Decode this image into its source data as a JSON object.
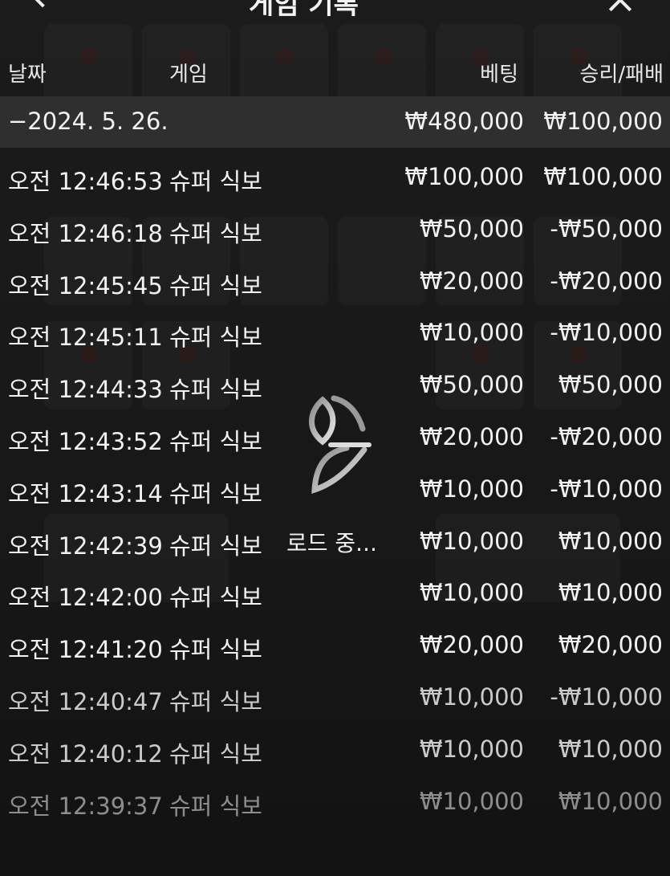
{
  "header": {
    "title": "게임 기록"
  },
  "columns": {
    "date": "날짜",
    "game": "게임",
    "bet": "베팅",
    "result": "승리/패배"
  },
  "date_group": {
    "date": "−2024. 5. 26.",
    "bet_total": "₩480,000",
    "result_total": "₩100,000"
  },
  "rows": [
    {
      "time": "오전 12:46:53",
      "game": "슈퍼 식보",
      "bet": "₩100,000",
      "result": "₩100,000"
    },
    {
      "time": "오전 12:46:18",
      "game": "슈퍼 식보",
      "bet": "₩50,000",
      "result": "-₩50,000"
    },
    {
      "time": "오전 12:45:45",
      "game": "슈퍼 식보",
      "bet": "₩20,000",
      "result": "-₩20,000"
    },
    {
      "time": "오전 12:45:11",
      "game": "슈퍼 식보",
      "bet": "₩10,000",
      "result": "-₩10,000"
    },
    {
      "time": "오전 12:44:33",
      "game": "슈퍼 식보",
      "bet": "₩50,000",
      "result": "₩50,000"
    },
    {
      "time": "오전 12:43:52",
      "game": "슈퍼 식보",
      "bet": "₩20,000",
      "result": "-₩20,000"
    },
    {
      "time": "오전 12:43:14",
      "game": "슈퍼 식보",
      "bet": "₩10,000",
      "result": "-₩10,000"
    },
    {
      "time": "오전 12:42:39",
      "game": "슈퍼 식보",
      "bet": "₩10,000",
      "result": "₩10,000"
    },
    {
      "time": "오전 12:42:00",
      "game": "슈퍼 식보",
      "bet": "₩10,000",
      "result": "₩10,000"
    },
    {
      "time": "오전 12:41:20",
      "game": "슈퍼 식보",
      "bet": "₩20,000",
      "result": "₩20,000"
    },
    {
      "time": "오전 12:40:47",
      "game": "슈퍼 식보",
      "bet": "₩10,000",
      "result": "-₩10,000"
    },
    {
      "time": "오전 12:40:12",
      "game": "슈퍼 식보",
      "bet": "₩10,000",
      "result": "₩10,000"
    },
    {
      "time": "오전 12:39:37",
      "game": "슈퍼 식보",
      "bet": "₩10,000",
      "result": "₩10,000"
    }
  ],
  "loading": {
    "text": "로드 중..."
  }
}
